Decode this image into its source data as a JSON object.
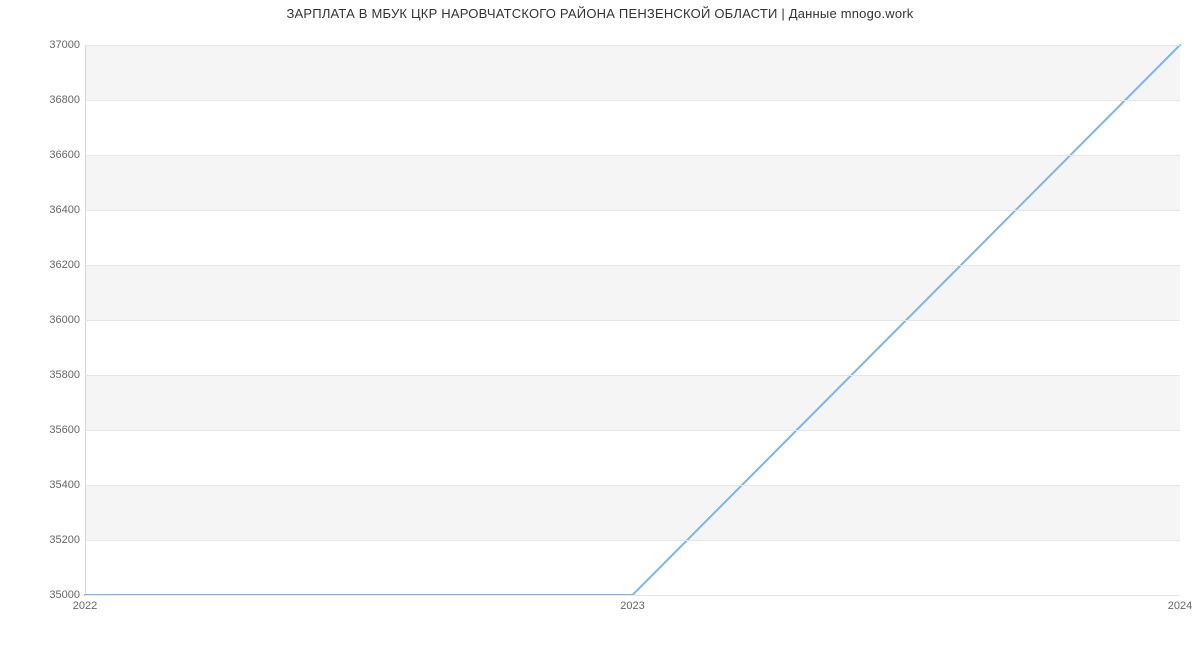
{
  "chart_data": {
    "type": "line",
    "title": "ЗАРПЛАТА В МБУК ЦКР НАРОВЧАТСКОГО РАЙОНА ПЕНЗЕНСКОЙ ОБЛАСТИ | Данные mnogo.work",
    "x": [
      2022,
      2023,
      2024
    ],
    "values": [
      35000,
      35000,
      37000
    ],
    "xlabel": "",
    "ylabel": "",
    "ylim": [
      35000,
      37000
    ],
    "y_ticks": [
      35000,
      35200,
      35400,
      35600,
      35800,
      36000,
      36200,
      36400,
      36600,
      36800,
      37000
    ],
    "x_ticks": [
      2022,
      2023,
      2024
    ],
    "line_color": "#7cb5ec"
  }
}
